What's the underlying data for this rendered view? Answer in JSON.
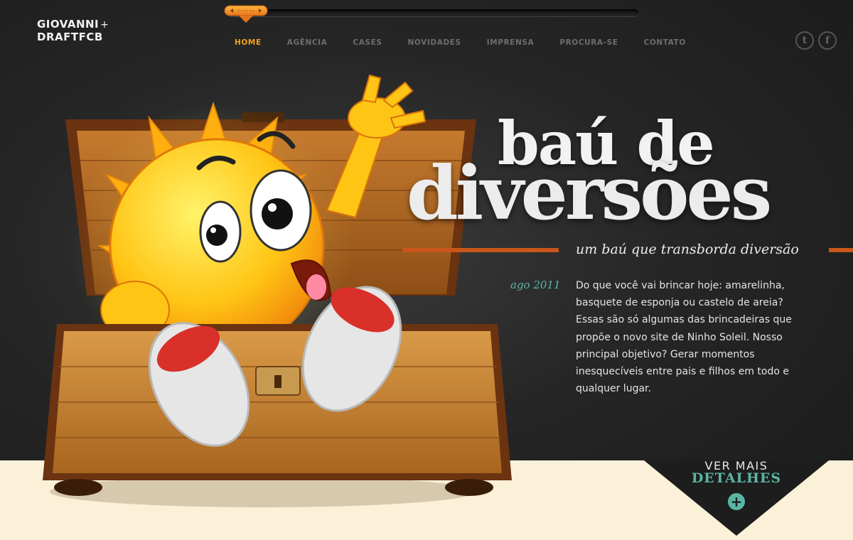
{
  "logo": {
    "line1": "GIOVANNI",
    "plus": "+",
    "line2": "DRAFTFCB"
  },
  "nav": {
    "items": [
      {
        "label": "HOME"
      },
      {
        "label": "AGÊNCIA"
      },
      {
        "label": "CASES"
      },
      {
        "label": "NOVIDADES"
      },
      {
        "label": "IMPRENSA"
      },
      {
        "label": "PROCURA-SE"
      },
      {
        "label": "CONTATO"
      }
    ],
    "active_color": "#f0a21a"
  },
  "social": {
    "twitter_label": "t",
    "facebook_label": "f",
    "icons": [
      "twitter-icon",
      "facebook-icon"
    ]
  },
  "hero": {
    "title_line1": "baú de",
    "title_line2": "diversões",
    "tagline": "um baú que transborda diversão",
    "date": "ago 2011",
    "body": "Do que você vai brincar hoje: amarelinha, basquete de esponja ou castelo de areia? Essas são só algumas das brincadeiras que propõe o novo site de Ninho Soleil. Nosso principal objetivo? Gerar momentos inesquecíveis entre pais e filhos em todo e qualquer lugar."
  },
  "cta": {
    "line1": "VER MAIS",
    "line2": "DETALHES",
    "plus": "+"
  },
  "colors": {
    "accent": "#c8561a",
    "teal": "#5ab6a4",
    "floor": "#faf1d8"
  }
}
